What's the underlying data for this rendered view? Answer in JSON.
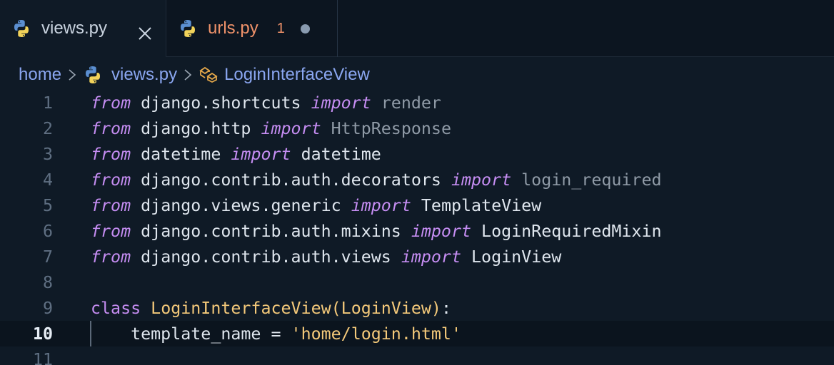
{
  "tabs": [
    {
      "label": "views.py",
      "icon": "python-icon",
      "active": true,
      "close": "×"
    },
    {
      "label": "urls.py",
      "icon": "python-icon",
      "active": false,
      "badge": "1",
      "modified": true
    }
  ],
  "breadcrumb": {
    "items": [
      "home",
      "views.py",
      "LoginInterfaceView"
    ],
    "separator_icon": "chevron-right-icon"
  },
  "editor": {
    "current_line": "10",
    "lines": [
      {
        "n": "1",
        "from": "from",
        "module": "django.shortcuts",
        "import": "import",
        "name": "render"
      },
      {
        "n": "2",
        "from": "from",
        "module": "django.http",
        "import": "import",
        "name": "HttpResponse"
      },
      {
        "n": "3",
        "from": "from",
        "module": "datetime",
        "import": "import",
        "name": "datetime"
      },
      {
        "n": "4",
        "from": "from",
        "module": "django.contrib.auth.decorators",
        "import": "import",
        "name": "login_required"
      },
      {
        "n": "5",
        "from": "from",
        "module": "django.views.generic",
        "import": "import",
        "name": "TemplateView"
      },
      {
        "n": "6",
        "from": "from",
        "module": "django.contrib.auth.mixins",
        "import": "import",
        "name": "LoginRequiredMixin"
      },
      {
        "n": "7",
        "from": "from",
        "module": "django.contrib.auth.views",
        "import": "import",
        "name": "LoginView"
      },
      {
        "n": "8"
      },
      {
        "n": "9",
        "class_kw": "class",
        "class_name": "LoginInterfaceView",
        "paren_open": "(",
        "base": "LoginView",
        "paren_close": ")",
        "colon": ":"
      },
      {
        "n": "10",
        "attr": "template_name",
        "eq": "=",
        "value": "'home/login.html'"
      },
      {
        "n": "11"
      }
    ]
  },
  "colors": {
    "background": "#0f1a26",
    "keyword": "#c58df2",
    "class_name": "#f4c97a",
    "string": "#f4c97a",
    "breadcrumb": "#8aa6f0",
    "modified_tab": "#f0926a"
  }
}
